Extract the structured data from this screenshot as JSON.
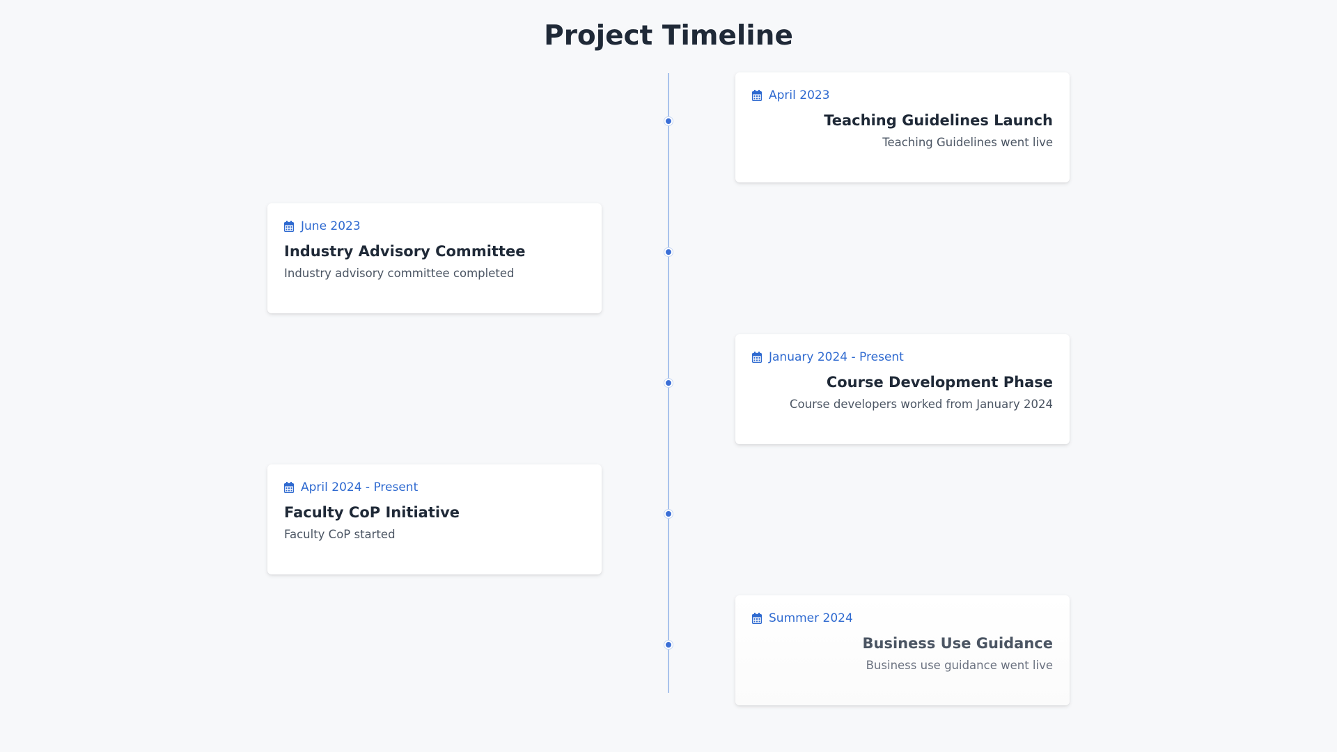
{
  "page": {
    "title": "Project Timeline"
  },
  "icons": {
    "date": "calendar-icon"
  },
  "colors": {
    "accent": "#2f6ad0",
    "axis": "#a9c3ec",
    "title": "#1f2937",
    "text": "#4b5563",
    "background": "#f7f8fa"
  },
  "events": [
    {
      "side": "right",
      "date": "April 2023",
      "title": "Teaching Guidelines Launch",
      "description": "Teaching Guidelines went live"
    },
    {
      "side": "left",
      "date": "June 2023",
      "title": "Industry Advisory Committee",
      "description": "Industry advisory committee completed"
    },
    {
      "side": "right",
      "date": "January 2024 - Present",
      "title": "Course Development Phase",
      "description": "Course developers worked from January 2024"
    },
    {
      "side": "left",
      "date": "April 2024 - Present",
      "title": "Faculty CoP Initiative",
      "description": "Faculty CoP started"
    },
    {
      "side": "right",
      "date": "Summer 2024",
      "title": "Business Use Guidance",
      "description": "Business use guidance went live"
    }
  ]
}
